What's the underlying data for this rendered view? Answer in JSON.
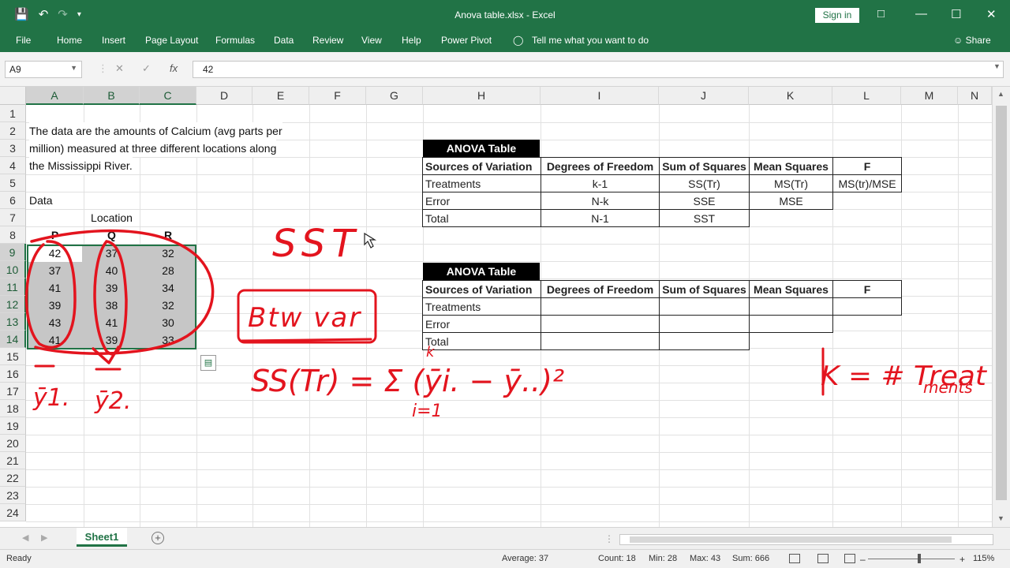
{
  "app": {
    "title": "Anova table.xlsx  -  Excel",
    "signin_label": "Sign in",
    "share_label": "Share",
    "tell_me": "Tell me what you want to do"
  },
  "ribbon_tabs": [
    "File",
    "Home",
    "Insert",
    "Page Layout",
    "Formulas",
    "Data",
    "Review",
    "View",
    "Help",
    "Power Pivot"
  ],
  "formula_bar": {
    "name_box": "A9",
    "formula": "42",
    "fx_label": "fx",
    "cancel_glyph": "✕",
    "enter_glyph": "✓"
  },
  "columns": [
    "A",
    "B",
    "C",
    "D",
    "E",
    "F",
    "G",
    "H",
    "I",
    "J",
    "K",
    "L",
    "M",
    "N"
  ],
  "rows": [
    "1",
    "2",
    "3",
    "4",
    "5",
    "6",
    "7",
    "8",
    "9",
    "10",
    "11",
    "12",
    "13",
    "14",
    "15",
    "16",
    "17",
    "18",
    "19",
    "20",
    "21",
    "22",
    "23",
    "24"
  ],
  "description": [
    "The data are the amounts of Calcium (avg parts per",
    "million) measured at three different locations along",
    "the Mississippi River."
  ],
  "data_label": "Data",
  "location_label": "Location",
  "location_headers": [
    "P",
    "Q",
    "R"
  ],
  "data_values": [
    [
      "42",
      "37",
      "32"
    ],
    [
      "37",
      "40",
      "28"
    ],
    [
      "41",
      "39",
      "34"
    ],
    [
      "39",
      "38",
      "32"
    ],
    [
      "43",
      "41",
      "30"
    ],
    [
      "41",
      "39",
      "33"
    ]
  ],
  "anova_table_1": {
    "title": "ANOVA Table",
    "headers": [
      "Sources of Variation",
      "Degrees of Freedom",
      "Sum of Squares",
      "Mean Squares",
      "F"
    ],
    "rows": [
      [
        "Treatments",
        "k-1",
        "SS(Tr)",
        "MS(Tr)",
        "MS(tr)/MSE"
      ],
      [
        "Error",
        "N-k",
        "SSE",
        "MSE",
        ""
      ],
      [
        "Total",
        "N-1",
        "SST",
        "",
        ""
      ]
    ]
  },
  "anova_table_2": {
    "title": "ANOVA Table",
    "headers": [
      "Sources of Variation",
      "Degrees of Freedom",
      "Sum of Squares",
      "Mean Squares",
      "F"
    ],
    "rows": [
      [
        "Treatments",
        "",
        "",
        "",
        ""
      ],
      [
        "Error",
        "",
        "",
        "",
        ""
      ],
      [
        "Total",
        "",
        "",
        "",
        ""
      ]
    ]
  },
  "annotations": {
    "sst": "SST",
    "btw_var": "Btw var",
    "ss_tr_formula": "SS(Tr) = Σ (ȳi. − ȳ..)²",
    "sum_upper": "k",
    "sum_lower": "i=1",
    "k_def_1": "K = # Treat",
    "k_def_2": "ments",
    "ybar_1": "ȳ1.",
    "ybar_2": "ȳ2.",
    "ink_color": "#e3141e"
  },
  "sheet_tab": "Sheet1",
  "status": {
    "ready": "Ready",
    "average": "Average: 37",
    "count": "Count: 18",
    "min": "Min: 28",
    "max": "Max: 43",
    "sum": "Sum: 666",
    "zoom": "115%"
  },
  "colors": {
    "excel_green": "#217346",
    "selection_gray": "#c6c6c6"
  }
}
